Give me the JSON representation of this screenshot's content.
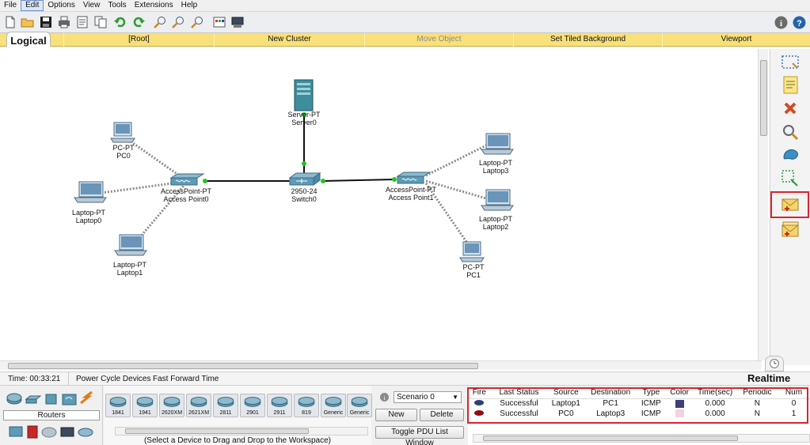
{
  "menu": [
    "File",
    "Edit",
    "Options",
    "View",
    "Tools",
    "Extensions",
    "Help"
  ],
  "toolbar": {
    "left_icons": [
      "new-file-icon",
      "open-folder-icon",
      "save-icon",
      "print-icon",
      "activity-wizard-icon",
      "copy-icon",
      "paste-icon",
      "undo-icon",
      "redo-icon",
      "zoom-in-icon",
      "zoom-reset-icon",
      "zoom-out-icon",
      "palette-icon",
      "custom-device-icon"
    ],
    "right_icons": [
      "info-icon",
      "help-icon"
    ]
  },
  "logical_bar": {
    "tab_label": "Logical",
    "items": [
      {
        "label": "[Root]",
        "enabled": true
      },
      {
        "label": "New Cluster",
        "enabled": true
      },
      {
        "label": "Move Object",
        "enabled": false
      },
      {
        "label": "Set Tiled Background",
        "enabled": true
      },
      {
        "label": "Viewport",
        "enabled": true
      }
    ]
  },
  "devices": [
    {
      "id": "server0",
      "model": "Server-PT",
      "name": "Server0"
    },
    {
      "id": "pc0",
      "model": "PC-PT",
      "name": "PC0"
    },
    {
      "id": "laptop0",
      "model": "Laptop-PT",
      "name": "Laptop0"
    },
    {
      "id": "laptop1",
      "model": "Laptop-PT",
      "name": "Laptop1"
    },
    {
      "id": "ap0",
      "model": "AccessPoint-PT",
      "name": "Access Point0"
    },
    {
      "id": "switch0",
      "model": "2950-24",
      "name": "Switch0"
    },
    {
      "id": "ap1",
      "model": "AccessPoint-PT",
      "name": "Access Point1"
    },
    {
      "id": "laptop3",
      "model": "Laptop-PT",
      "name": "Laptop3"
    },
    {
      "id": "laptop2",
      "model": "Laptop-PT",
      "name": "Laptop2"
    },
    {
      "id": "pc1",
      "model": "PC-PT",
      "name": "PC1"
    }
  ],
  "palette_tools": [
    "select-icon",
    "note-icon",
    "delete-icon",
    "inspect-icon",
    "draw-shape-icon",
    "resize-icon",
    "add-simple-pdu-icon",
    "add-complex-pdu-icon"
  ],
  "status": {
    "time": "Time: 00:33:21",
    "power_cycle": "Power Cycle Devices",
    "fast_forward": "Fast Forward Time",
    "mode": "Realtime"
  },
  "device_panel": {
    "category_label": "Routers",
    "models": [
      "1841",
      "1941",
      "2620XM",
      "2621XM",
      "2811",
      "2901",
      "2911",
      "819",
      "Generic",
      "Generic"
    ],
    "hint": "(Select a Device to Drag and Drop to the Workspace)"
  },
  "scenario": {
    "selected": "Scenario 0",
    "new_label": "New",
    "delete_label": "Delete",
    "toggle_label": "Toggle PDU List Window"
  },
  "pdu_list": {
    "headers": [
      "Fire",
      "Last Status",
      "Source",
      "Destination",
      "Type",
      "Color",
      "Time(sec)",
      "Periodic",
      "Num"
    ],
    "rows": [
      {
        "fire": "navy",
        "status": "Successful",
        "source": "Laptop1",
        "destination": "PC1",
        "type": "ICMP",
        "color": "#3c3f7a",
        "time": "0.000",
        "periodic": "N",
        "num": "0"
      },
      {
        "fire": "red",
        "status": "Successful",
        "source": "PC0",
        "destination": "Laptop3",
        "type": "ICMP",
        "color": "#f3d2e4",
        "time": "0.000",
        "periodic": "N",
        "num": "1"
      }
    ]
  }
}
